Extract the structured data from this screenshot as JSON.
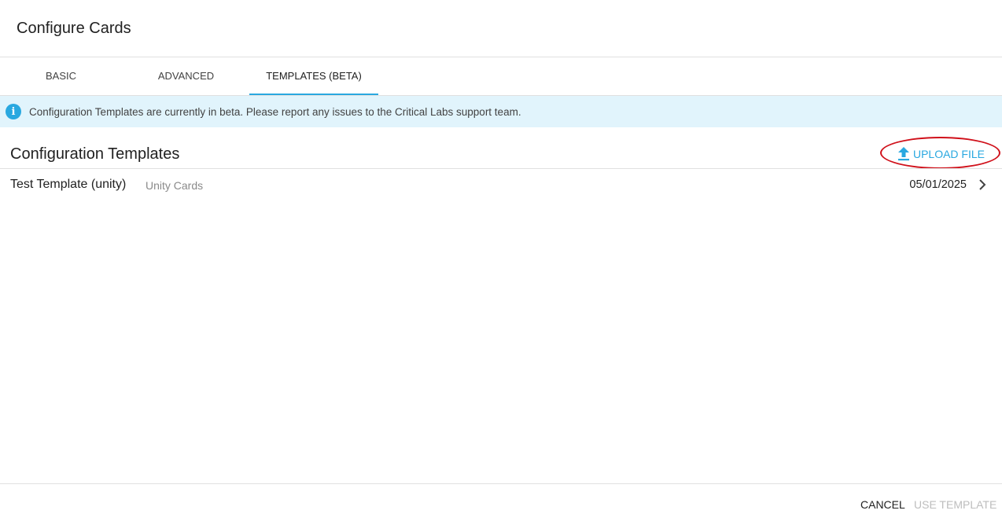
{
  "dialog": {
    "title": "Configure Cards"
  },
  "tabs": [
    {
      "label": "BASIC"
    },
    {
      "label": "ADVANCED"
    },
    {
      "label": "TEMPLATES (BETA)"
    }
  ],
  "active_tab": "TEMPLATES (BETA)",
  "banner": {
    "icon": "info-icon",
    "text": "Configuration Templates are currently in beta. Please report any issues to the Critical Labs support team."
  },
  "section": {
    "title": "Configuration Templates",
    "upload_label": "UPLOAD FILE",
    "upload_icon": "upload-icon"
  },
  "templates": [
    {
      "name": "Test Template (unity)",
      "type": "Unity Cards",
      "date": "05/01/2025",
      "icon": "chevron-right-icon"
    }
  ],
  "footer": {
    "cancel_label": "CANCEL",
    "use_label": "USE TEMPLATE"
  },
  "colors": {
    "accent": "#29a8e0",
    "banner_bg": "#e1f4fc",
    "annotation": "#d0101a",
    "disabled": "#bdbdbd"
  }
}
